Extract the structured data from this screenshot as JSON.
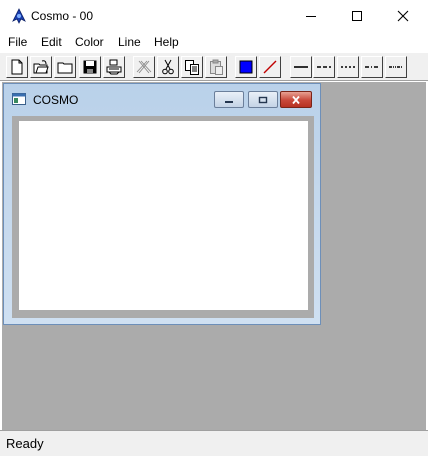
{
  "window": {
    "title": "Cosmo - 00"
  },
  "icons": {
    "app": "cosmo-app-icon",
    "minimize": "minimize-icon",
    "maximize": "maximize-icon",
    "close": "close-icon"
  },
  "menu": [
    "File",
    "Edit",
    "Color",
    "Line",
    "Help"
  ],
  "toolbar": {
    "buttons": [
      "new-file-icon",
      "open-file-icon",
      "open-folder-icon",
      "save-icon",
      "print-icon",
      "cut-disabled-icon",
      "scissors-icon",
      "copy-icon",
      "paste-icon",
      "color-blue-icon",
      "line-color-icon",
      "line-solid-icon",
      "line-dash-icon",
      "line-dot-icon",
      "line-dashdot-icon",
      "line-dashdotdot-icon"
    ],
    "colors": {
      "selected_color": "#0000ff",
      "line_color": "#c00000"
    }
  },
  "child_window": {
    "title": "COSMO"
  },
  "status": {
    "text": "Ready"
  }
}
